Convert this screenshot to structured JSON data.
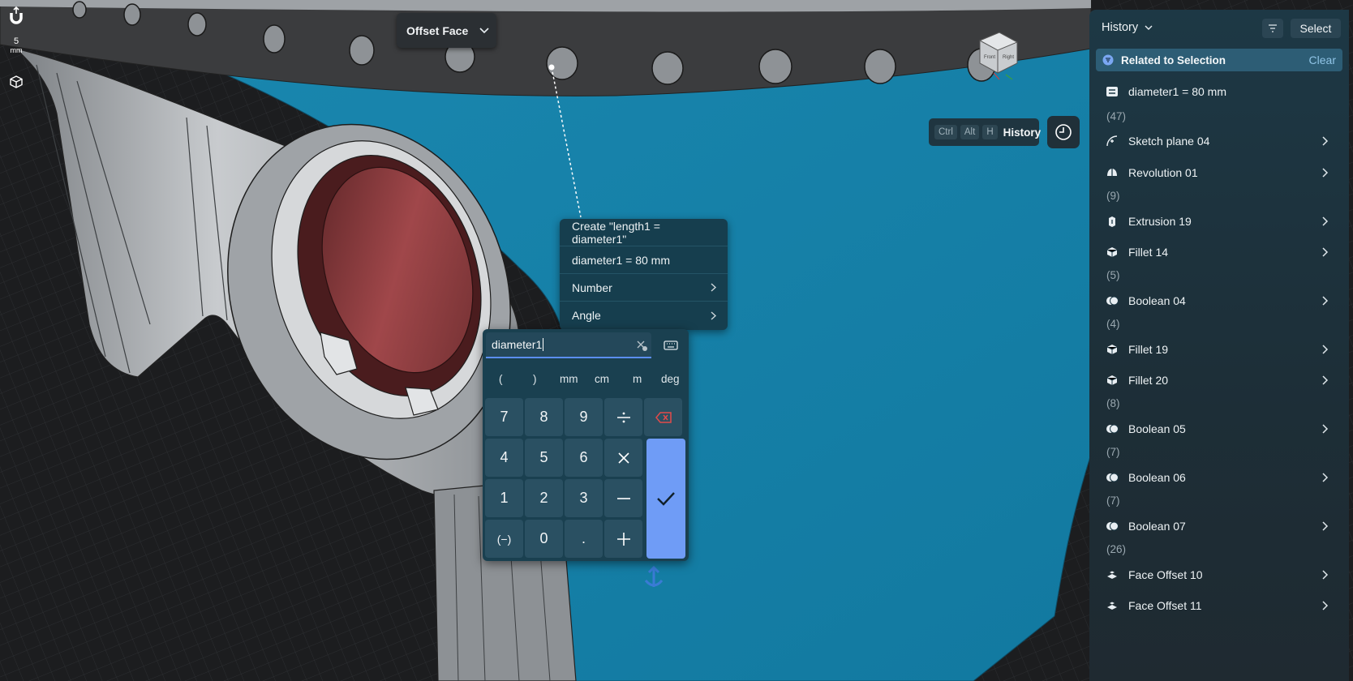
{
  "tool_dropdown": {
    "label": "Offset Face"
  },
  "snap": {
    "value": "5",
    "unit": "mm"
  },
  "history_shortcut": {
    "keys": [
      "Ctrl",
      "Alt",
      "H"
    ],
    "label": "History"
  },
  "context_menu": {
    "items": [
      {
        "label": "Create \"length1 = diameter1\"",
        "has_submenu": false
      },
      {
        "label": "diameter1 = 80 mm",
        "has_submenu": false
      },
      {
        "label": "Number",
        "has_submenu": true
      },
      {
        "label": "Angle",
        "has_submenu": true
      }
    ]
  },
  "keypad": {
    "input_value": "diameter1",
    "units": [
      "(",
      ")",
      "mm",
      "cm",
      "m",
      "deg"
    ],
    "keys": [
      "7",
      "8",
      "9",
      "4",
      "5",
      "6",
      "1",
      "2",
      "3",
      "(−)",
      "0",
      "."
    ],
    "ops": [
      "divide",
      "multiply",
      "minus",
      "plus"
    ],
    "accent": "#6f9cf6"
  },
  "history_panel": {
    "title": "History",
    "select_label": "Select",
    "related_label": "Related to Selection",
    "clear_label": "Clear",
    "rows": [
      {
        "kind": "item",
        "label": "diameter1 = 80 mm",
        "icon": "variable-icon",
        "chevron": false
      },
      {
        "kind": "count",
        "label": "(47)"
      },
      {
        "kind": "item",
        "label": "Sketch plane 04",
        "icon": "sketch-plane-icon",
        "chevron": true
      },
      {
        "kind": "item",
        "label": "Revolution 01",
        "icon": "revolution-icon",
        "chevron": true
      },
      {
        "kind": "count",
        "label": "(9)"
      },
      {
        "kind": "item",
        "label": "Extrusion 19",
        "icon": "extrusion-icon",
        "chevron": true
      },
      {
        "kind": "item",
        "label": "Fillet 14",
        "icon": "fillet-icon",
        "chevron": true
      },
      {
        "kind": "count",
        "label": "(5)"
      },
      {
        "kind": "item",
        "label": "Boolean 04",
        "icon": "boolean-icon",
        "chevron": true
      },
      {
        "kind": "count",
        "label": "(4)"
      },
      {
        "kind": "item",
        "label": "Fillet 19",
        "icon": "fillet-icon",
        "chevron": true
      },
      {
        "kind": "item",
        "label": "Fillet 20",
        "icon": "fillet-icon",
        "chevron": true
      },
      {
        "kind": "count",
        "label": "(8)"
      },
      {
        "kind": "item",
        "label": "Boolean 05",
        "icon": "boolean-icon",
        "chevron": true
      },
      {
        "kind": "count",
        "label": "(7)"
      },
      {
        "kind": "item",
        "label": "Boolean 06",
        "icon": "boolean-icon",
        "chevron": true
      },
      {
        "kind": "count",
        "label": "(7)"
      },
      {
        "kind": "item",
        "label": "Boolean 07",
        "icon": "boolean-icon",
        "chevron": true
      },
      {
        "kind": "count",
        "label": "(26)"
      },
      {
        "kind": "item",
        "label": "Face Offset 10",
        "icon": "face-offset-icon",
        "chevron": true
      },
      {
        "kind": "item",
        "label": "Face Offset 11",
        "icon": "face-offset-icon",
        "chevron": true
      }
    ]
  },
  "colors": {
    "model_blue": "#1685ad",
    "rim_dark": "#3a3a3a",
    "lens_red": "#8a3a3a",
    "housing_gray": "#a9acb0",
    "panel_bg": "#1d3845"
  }
}
